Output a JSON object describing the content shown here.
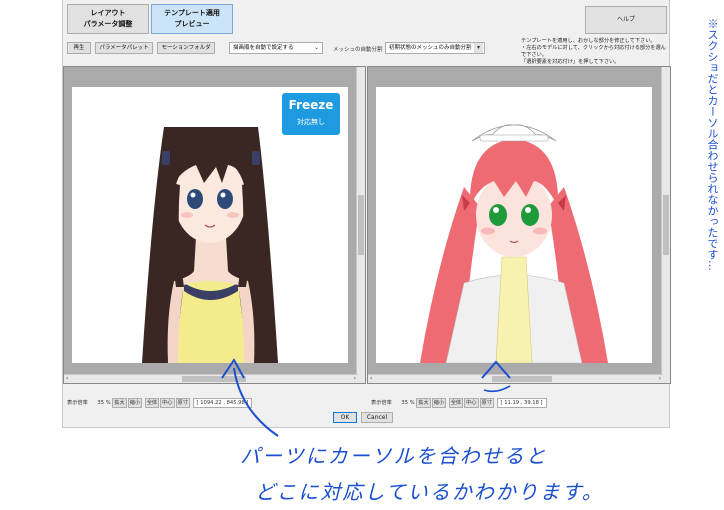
{
  "toolbar": {
    "tab_layout_line1": "レイアウト",
    "tab_layout_line2": "パラメータ調整",
    "tab_template_line1": "テンプレート適用",
    "tab_template_line2": "プレビュー",
    "help_label": "ヘルプ",
    "play_label": "再生",
    "param_palette_label": "パラメータパレット",
    "motion_folder_label": "モーションフォルダ",
    "draw_order_select": "描画順を自動で設定する",
    "mesh_auto_label": "メッシュの自動分割",
    "mesh_auto_select": "初期状態のメッシュのみ自動分割",
    "note_line1": "テンプレートを適用し、おかしな部分を修正して下さい。",
    "note_line2": "・左右のモデルに対して、クリックから対応付ける部分を選んで下さい。",
    "note_line3": "「選択要素を対応付け」を押して下さい。"
  },
  "left_pane": {
    "badge_title": "Freeze",
    "badge_sub": "対応無し",
    "status_label": "表示倍率",
    "zoom": "35",
    "zoom_unit": "%",
    "btn_zoom_in": "拡大",
    "btn_zoom_out": "縮小",
    "btn_all": "全体",
    "btn_center": "中心",
    "btn_actual": "原寸",
    "coord": "[ 1094.22 , 845.98 ]"
  },
  "right_pane": {
    "status_label": "表示倍率",
    "zoom": "35",
    "zoom_unit": "%",
    "btn_zoom_in": "拡大",
    "btn_zoom_out": "縮小",
    "btn_all": "全体",
    "btn_center": "中心",
    "btn_actual": "原寸",
    "coord": "[ 11.19 , 39.18 ]"
  },
  "dialog": {
    "ok_label": "OK",
    "cancel_label": "Cancel"
  },
  "annotations": {
    "bottom_line1": "パーツにカーソルを合わせると",
    "bottom_line2": "どこに対応しているかわかります。",
    "side_note": "※スクショだとカーソル合わせられなかったです…"
  },
  "colors": {
    "handwriting": "#1a4fd0",
    "freeze_badge": "#1e9ae0",
    "active_tab": "#cce4f7"
  }
}
